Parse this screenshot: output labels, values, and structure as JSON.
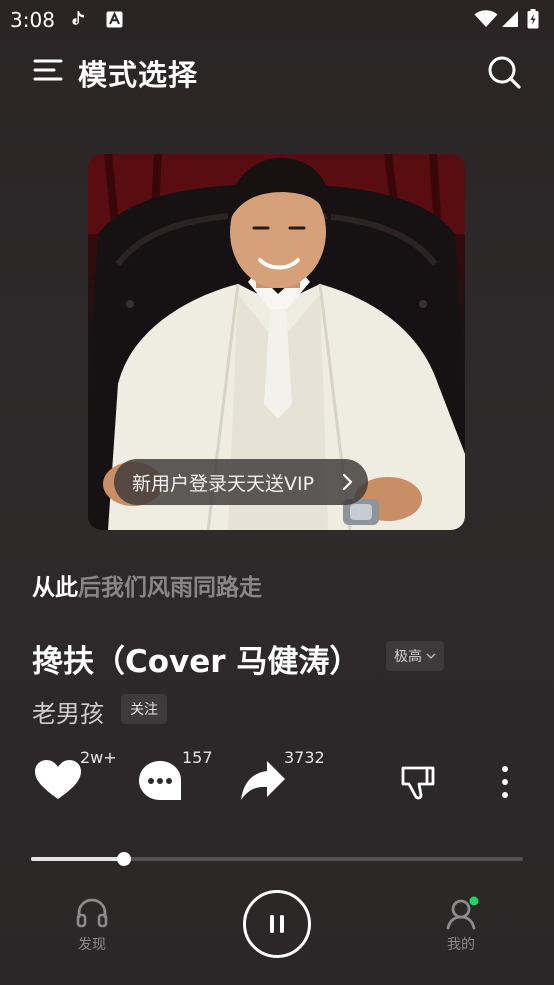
{
  "status_bar": {
    "time": "3:08"
  },
  "header": {
    "title": "模式选择"
  },
  "album": {
    "vip_banner": "新用户登录天天送VIP"
  },
  "lyric": {
    "highlight": "从此",
    "rest": "后我们风雨同路走"
  },
  "song": {
    "title": "搀扶（Cover 马健涛）",
    "quality": "极高",
    "artist": "老男孩",
    "follow_label": "关注"
  },
  "actions": {
    "like_count": "2w+",
    "comment_count": "157",
    "share_count": "3732"
  },
  "progress": {
    "played_fraction": 0.19,
    "buffered_fraction": 0.09
  },
  "nav": {
    "discover_label": "发现",
    "mine_label": "我的"
  },
  "colors": {
    "accent_dot": "#1ed760",
    "background": "#2b2728"
  }
}
